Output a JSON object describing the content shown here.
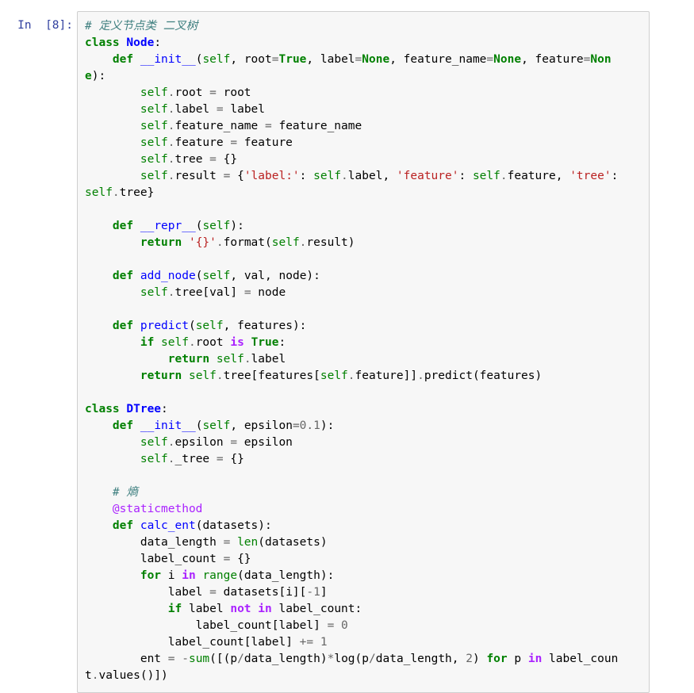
{
  "cell": {
    "prompt": "In  [8]:"
  },
  "code_lines": [
    [
      {
        "t": "c",
        "v": "# 定义节点类 二叉树"
      }
    ],
    [
      {
        "t": "kw",
        "v": "class"
      },
      {
        "t": "n",
        "v": " "
      },
      {
        "t": "nc",
        "v": "Node"
      },
      {
        "t": "p",
        "v": ":"
      }
    ],
    [
      {
        "t": "n",
        "v": "    "
      },
      {
        "t": "kw",
        "v": "def"
      },
      {
        "t": "n",
        "v": " "
      },
      {
        "t": "nf",
        "v": "__init__"
      },
      {
        "t": "p",
        "v": "("
      },
      {
        "t": "bp",
        "v": "self"
      },
      {
        "t": "p",
        "v": ", "
      },
      {
        "t": "n",
        "v": "root"
      },
      {
        "t": "o",
        "v": "="
      },
      {
        "t": "kc",
        "v": "True"
      },
      {
        "t": "p",
        "v": ", "
      },
      {
        "t": "n",
        "v": "label"
      },
      {
        "t": "o",
        "v": "="
      },
      {
        "t": "kc",
        "v": "None"
      },
      {
        "t": "p",
        "v": ", "
      },
      {
        "t": "n",
        "v": "feature_name"
      },
      {
        "t": "o",
        "v": "="
      },
      {
        "t": "kc",
        "v": "None"
      },
      {
        "t": "p",
        "v": ", "
      },
      {
        "t": "n",
        "v": "feature"
      },
      {
        "t": "o",
        "v": "="
      },
      {
        "t": "kc",
        "v": "Non"
      }
    ],
    [
      {
        "t": "kc",
        "v": "e"
      },
      {
        "t": "p",
        "v": "):"
      }
    ],
    [
      {
        "t": "n",
        "v": "        "
      },
      {
        "t": "bp",
        "v": "self"
      },
      {
        "t": "o",
        "v": "."
      },
      {
        "t": "n",
        "v": "root "
      },
      {
        "t": "o",
        "v": "="
      },
      {
        "t": "n",
        "v": " root"
      }
    ],
    [
      {
        "t": "n",
        "v": "        "
      },
      {
        "t": "bp",
        "v": "self"
      },
      {
        "t": "o",
        "v": "."
      },
      {
        "t": "n",
        "v": "label "
      },
      {
        "t": "o",
        "v": "="
      },
      {
        "t": "n",
        "v": " label"
      }
    ],
    [
      {
        "t": "n",
        "v": "        "
      },
      {
        "t": "bp",
        "v": "self"
      },
      {
        "t": "o",
        "v": "."
      },
      {
        "t": "n",
        "v": "feature_name "
      },
      {
        "t": "o",
        "v": "="
      },
      {
        "t": "n",
        "v": " feature_name"
      }
    ],
    [
      {
        "t": "n",
        "v": "        "
      },
      {
        "t": "bp",
        "v": "self"
      },
      {
        "t": "o",
        "v": "."
      },
      {
        "t": "n",
        "v": "feature "
      },
      {
        "t": "o",
        "v": "="
      },
      {
        "t": "n",
        "v": " feature"
      }
    ],
    [
      {
        "t": "n",
        "v": "        "
      },
      {
        "t": "bp",
        "v": "self"
      },
      {
        "t": "o",
        "v": "."
      },
      {
        "t": "n",
        "v": "tree "
      },
      {
        "t": "o",
        "v": "="
      },
      {
        "t": "n",
        "v": " "
      },
      {
        "t": "p",
        "v": "{}"
      }
    ],
    [
      {
        "t": "n",
        "v": "        "
      },
      {
        "t": "bp",
        "v": "self"
      },
      {
        "t": "o",
        "v": "."
      },
      {
        "t": "n",
        "v": "result "
      },
      {
        "t": "o",
        "v": "="
      },
      {
        "t": "n",
        "v": " "
      },
      {
        "t": "p",
        "v": "{"
      },
      {
        "t": "s",
        "v": "'label:'"
      },
      {
        "t": "p",
        "v": ": "
      },
      {
        "t": "bp",
        "v": "self"
      },
      {
        "t": "o",
        "v": "."
      },
      {
        "t": "n",
        "v": "label"
      },
      {
        "t": "p",
        "v": ", "
      },
      {
        "t": "s",
        "v": "'feature'"
      },
      {
        "t": "p",
        "v": ": "
      },
      {
        "t": "bp",
        "v": "self"
      },
      {
        "t": "o",
        "v": "."
      },
      {
        "t": "n",
        "v": "feature"
      },
      {
        "t": "p",
        "v": ", "
      },
      {
        "t": "s",
        "v": "'tree'"
      },
      {
        "t": "p",
        "v": ":"
      }
    ],
    [
      {
        "t": "bp",
        "v": "self"
      },
      {
        "t": "o",
        "v": "."
      },
      {
        "t": "n",
        "v": "tree"
      },
      {
        "t": "p",
        "v": "}"
      }
    ],
    [],
    [
      {
        "t": "n",
        "v": "    "
      },
      {
        "t": "kw",
        "v": "def"
      },
      {
        "t": "n",
        "v": " "
      },
      {
        "t": "nf",
        "v": "__repr__"
      },
      {
        "t": "p",
        "v": "("
      },
      {
        "t": "bp",
        "v": "self"
      },
      {
        "t": "p",
        "v": "):"
      }
    ],
    [
      {
        "t": "n",
        "v": "        "
      },
      {
        "t": "kw",
        "v": "return"
      },
      {
        "t": "n",
        "v": " "
      },
      {
        "t": "s",
        "v": "'{}'"
      },
      {
        "t": "o",
        "v": "."
      },
      {
        "t": "n",
        "v": "format"
      },
      {
        "t": "p",
        "v": "("
      },
      {
        "t": "bp",
        "v": "self"
      },
      {
        "t": "o",
        "v": "."
      },
      {
        "t": "n",
        "v": "result"
      },
      {
        "t": "p",
        "v": ")"
      }
    ],
    [],
    [
      {
        "t": "n",
        "v": "    "
      },
      {
        "t": "kw",
        "v": "def"
      },
      {
        "t": "n",
        "v": " "
      },
      {
        "t": "nf",
        "v": "add_node"
      },
      {
        "t": "p",
        "v": "("
      },
      {
        "t": "bp",
        "v": "self"
      },
      {
        "t": "p",
        "v": ", "
      },
      {
        "t": "n",
        "v": "val"
      },
      {
        "t": "p",
        "v": ", "
      },
      {
        "t": "n",
        "v": "node"
      },
      {
        "t": "p",
        "v": "):"
      }
    ],
    [
      {
        "t": "n",
        "v": "        "
      },
      {
        "t": "bp",
        "v": "self"
      },
      {
        "t": "o",
        "v": "."
      },
      {
        "t": "n",
        "v": "tree"
      },
      {
        "t": "p",
        "v": "["
      },
      {
        "t": "n",
        "v": "val"
      },
      {
        "t": "p",
        "v": "]"
      },
      {
        "t": "n",
        "v": " "
      },
      {
        "t": "o",
        "v": "="
      },
      {
        "t": "n",
        "v": " node"
      }
    ],
    [],
    [
      {
        "t": "n",
        "v": "    "
      },
      {
        "t": "kw",
        "v": "def"
      },
      {
        "t": "n",
        "v": " "
      },
      {
        "t": "nf",
        "v": "predict"
      },
      {
        "t": "p",
        "v": "("
      },
      {
        "t": "bp",
        "v": "self"
      },
      {
        "t": "p",
        "v": ", "
      },
      {
        "t": "n",
        "v": "features"
      },
      {
        "t": "p",
        "v": "):"
      }
    ],
    [
      {
        "t": "n",
        "v": "        "
      },
      {
        "t": "kw",
        "v": "if"
      },
      {
        "t": "n",
        "v": " "
      },
      {
        "t": "bp",
        "v": "self"
      },
      {
        "t": "o",
        "v": "."
      },
      {
        "t": "n",
        "v": "root "
      },
      {
        "t": "ow",
        "v": "is"
      },
      {
        "t": "n",
        "v": " "
      },
      {
        "t": "kc",
        "v": "True"
      },
      {
        "t": "p",
        "v": ":"
      }
    ],
    [
      {
        "t": "n",
        "v": "            "
      },
      {
        "t": "kw",
        "v": "return"
      },
      {
        "t": "n",
        "v": " "
      },
      {
        "t": "bp",
        "v": "self"
      },
      {
        "t": "o",
        "v": "."
      },
      {
        "t": "n",
        "v": "label"
      }
    ],
    [
      {
        "t": "n",
        "v": "        "
      },
      {
        "t": "kw",
        "v": "return"
      },
      {
        "t": "n",
        "v": " "
      },
      {
        "t": "bp",
        "v": "self"
      },
      {
        "t": "o",
        "v": "."
      },
      {
        "t": "n",
        "v": "tree"
      },
      {
        "t": "p",
        "v": "["
      },
      {
        "t": "n",
        "v": "features"
      },
      {
        "t": "p",
        "v": "["
      },
      {
        "t": "bp",
        "v": "self"
      },
      {
        "t": "o",
        "v": "."
      },
      {
        "t": "n",
        "v": "feature"
      },
      {
        "t": "p",
        "v": "]]"
      },
      {
        "t": "o",
        "v": "."
      },
      {
        "t": "n",
        "v": "predict"
      },
      {
        "t": "p",
        "v": "("
      },
      {
        "t": "n",
        "v": "features"
      },
      {
        "t": "p",
        "v": ")"
      }
    ],
    [],
    [
      {
        "t": "kw",
        "v": "class"
      },
      {
        "t": "n",
        "v": " "
      },
      {
        "t": "nc",
        "v": "DTree"
      },
      {
        "t": "p",
        "v": ":"
      }
    ],
    [
      {
        "t": "n",
        "v": "    "
      },
      {
        "t": "kw",
        "v": "def"
      },
      {
        "t": "n",
        "v": " "
      },
      {
        "t": "nf",
        "v": "__init__"
      },
      {
        "t": "p",
        "v": "("
      },
      {
        "t": "bp",
        "v": "self"
      },
      {
        "t": "p",
        "v": ", "
      },
      {
        "t": "n",
        "v": "epsilon"
      },
      {
        "t": "o",
        "v": "="
      },
      {
        "t": "mi",
        "v": "0.1"
      },
      {
        "t": "p",
        "v": "):"
      }
    ],
    [
      {
        "t": "n",
        "v": "        "
      },
      {
        "t": "bp",
        "v": "self"
      },
      {
        "t": "o",
        "v": "."
      },
      {
        "t": "n",
        "v": "epsilon "
      },
      {
        "t": "o",
        "v": "="
      },
      {
        "t": "n",
        "v": " epsilon"
      }
    ],
    [
      {
        "t": "n",
        "v": "        "
      },
      {
        "t": "bp",
        "v": "self"
      },
      {
        "t": "o",
        "v": "."
      },
      {
        "t": "n",
        "v": "_tree "
      },
      {
        "t": "o",
        "v": "="
      },
      {
        "t": "n",
        "v": " "
      },
      {
        "t": "p",
        "v": "{}"
      }
    ],
    [],
    [
      {
        "t": "n",
        "v": "    "
      },
      {
        "t": "c",
        "v": "# 熵"
      }
    ],
    [
      {
        "t": "n",
        "v": "    "
      },
      {
        "t": "nd",
        "v": "@staticmethod"
      }
    ],
    [
      {
        "t": "n",
        "v": "    "
      },
      {
        "t": "kw",
        "v": "def"
      },
      {
        "t": "n",
        "v": " "
      },
      {
        "t": "nf",
        "v": "calc_ent"
      },
      {
        "t": "p",
        "v": "("
      },
      {
        "t": "n",
        "v": "datasets"
      },
      {
        "t": "p",
        "v": "):"
      }
    ],
    [
      {
        "t": "n",
        "v": "        data_length "
      },
      {
        "t": "o",
        "v": "="
      },
      {
        "t": "n",
        "v": " "
      },
      {
        "t": "nb",
        "v": "len"
      },
      {
        "t": "p",
        "v": "("
      },
      {
        "t": "n",
        "v": "datasets"
      },
      {
        "t": "p",
        "v": ")"
      }
    ],
    [
      {
        "t": "n",
        "v": "        label_count "
      },
      {
        "t": "o",
        "v": "="
      },
      {
        "t": "n",
        "v": " "
      },
      {
        "t": "p",
        "v": "{}"
      }
    ],
    [
      {
        "t": "n",
        "v": "        "
      },
      {
        "t": "kw",
        "v": "for"
      },
      {
        "t": "n",
        "v": " i "
      },
      {
        "t": "ow",
        "v": "in"
      },
      {
        "t": "n",
        "v": " "
      },
      {
        "t": "nb",
        "v": "range"
      },
      {
        "t": "p",
        "v": "("
      },
      {
        "t": "n",
        "v": "data_length"
      },
      {
        "t": "p",
        "v": "):"
      }
    ],
    [
      {
        "t": "n",
        "v": "            label "
      },
      {
        "t": "o",
        "v": "="
      },
      {
        "t": "n",
        "v": " datasets"
      },
      {
        "t": "p",
        "v": "["
      },
      {
        "t": "n",
        "v": "i"
      },
      {
        "t": "p",
        "v": "]["
      },
      {
        "t": "o",
        "v": "-"
      },
      {
        "t": "mi",
        "v": "1"
      },
      {
        "t": "p",
        "v": "]"
      }
    ],
    [
      {
        "t": "n",
        "v": "            "
      },
      {
        "t": "kw",
        "v": "if"
      },
      {
        "t": "n",
        "v": " label "
      },
      {
        "t": "ow",
        "v": "not"
      },
      {
        "t": "n",
        "v": " "
      },
      {
        "t": "ow",
        "v": "in"
      },
      {
        "t": "n",
        "v": " label_count"
      },
      {
        "t": "p",
        "v": ":"
      }
    ],
    [
      {
        "t": "n",
        "v": "                label_count"
      },
      {
        "t": "p",
        "v": "["
      },
      {
        "t": "n",
        "v": "label"
      },
      {
        "t": "p",
        "v": "]"
      },
      {
        "t": "n",
        "v": " "
      },
      {
        "t": "o",
        "v": "="
      },
      {
        "t": "n",
        "v": " "
      },
      {
        "t": "mi",
        "v": "0"
      }
    ],
    [
      {
        "t": "n",
        "v": "            label_count"
      },
      {
        "t": "p",
        "v": "["
      },
      {
        "t": "n",
        "v": "label"
      },
      {
        "t": "p",
        "v": "]"
      },
      {
        "t": "n",
        "v": " "
      },
      {
        "t": "o",
        "v": "+="
      },
      {
        "t": "n",
        "v": " "
      },
      {
        "t": "mi",
        "v": "1"
      }
    ],
    [
      {
        "t": "n",
        "v": "        ent "
      },
      {
        "t": "o",
        "v": "="
      },
      {
        "t": "n",
        "v": " "
      },
      {
        "t": "o",
        "v": "-"
      },
      {
        "t": "nb",
        "v": "sum"
      },
      {
        "t": "p",
        "v": "([("
      },
      {
        "t": "n",
        "v": "p"
      },
      {
        "t": "o",
        "v": "/"
      },
      {
        "t": "n",
        "v": "data_length"
      },
      {
        "t": "p",
        "v": ")"
      },
      {
        "t": "o",
        "v": "*"
      },
      {
        "t": "n",
        "v": "log"
      },
      {
        "t": "p",
        "v": "("
      },
      {
        "t": "n",
        "v": "p"
      },
      {
        "t": "o",
        "v": "/"
      },
      {
        "t": "n",
        "v": "data_length"
      },
      {
        "t": "p",
        "v": ", "
      },
      {
        "t": "mi",
        "v": "2"
      },
      {
        "t": "p",
        "v": ") "
      },
      {
        "t": "kw",
        "v": "for"
      },
      {
        "t": "n",
        "v": " p "
      },
      {
        "t": "ow",
        "v": "in"
      },
      {
        "t": "n",
        "v": " label_coun"
      }
    ],
    [
      {
        "t": "n",
        "v": "t"
      },
      {
        "t": "o",
        "v": "."
      },
      {
        "t": "n",
        "v": "values"
      },
      {
        "t": "p",
        "v": "()])"
      }
    ]
  ]
}
